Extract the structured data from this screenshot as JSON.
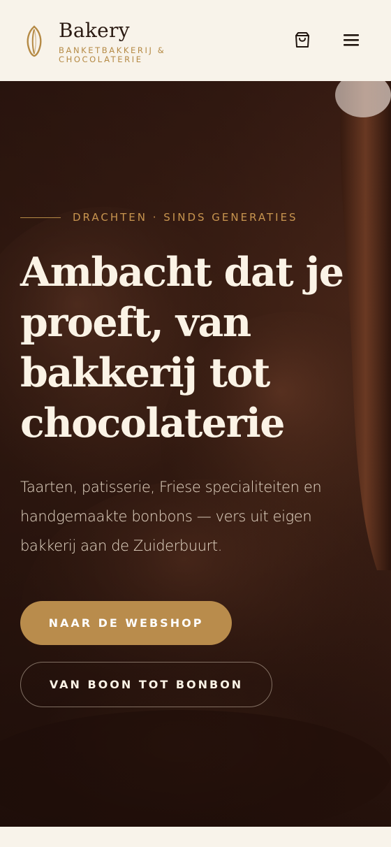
{
  "header": {
    "brand_name": "Bakery",
    "brand_tagline": "BANKETBAKKERIJ & CHOCOLATERIE",
    "logo_icon": "cocoa-bean-icon",
    "cart_icon": "shopping-bag-icon",
    "menu_icon": "hamburger-menu-icon"
  },
  "hero": {
    "eyebrow": "DRACHTEN · SINDS GENERATIES",
    "title": "Ambacht dat je proeft, van bakkerij tot chocolaterie",
    "lead": "Taarten, patisserie, Friese specialiteiten en handgemaakte bonbons — vers uit eigen bakkerij aan de Zuiderbuurt.",
    "primary_cta": "NAAR DE WEBSHOP",
    "secondary_cta": "VAN BOON TOT BONBON"
  },
  "colors": {
    "accent": "#b98c4c",
    "hero_bg": "#3a1d14",
    "header_bg": "#f8f3ea",
    "text_light": "#fbf3e6"
  }
}
